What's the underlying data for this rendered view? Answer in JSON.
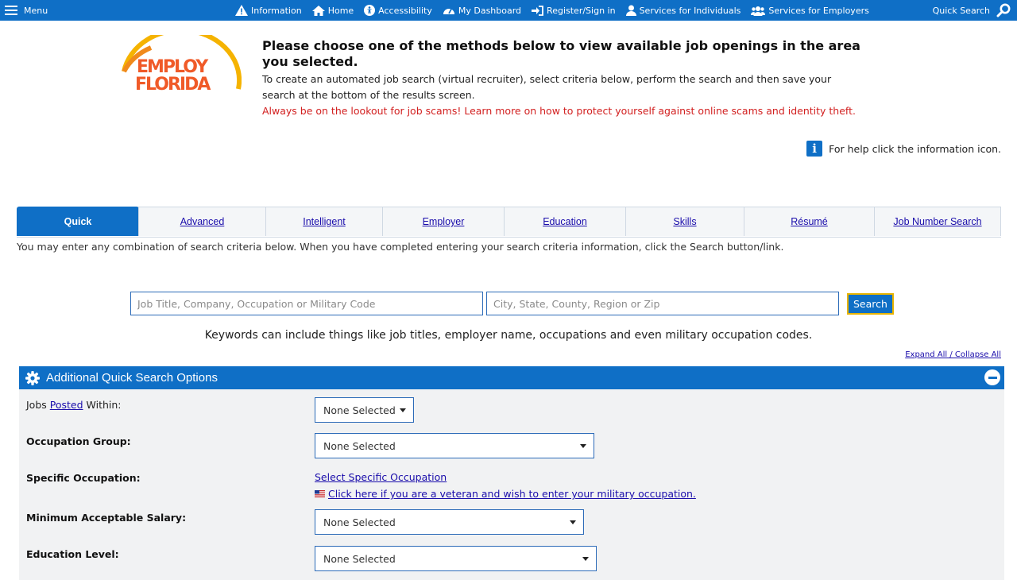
{
  "topbar": {
    "menu_label": "Menu",
    "nav": [
      {
        "label": "Information",
        "icon": "warning-icon"
      },
      {
        "label": "Home",
        "icon": "home-icon"
      },
      {
        "label": "Accessibility",
        "icon": "accessibility-icon"
      },
      {
        "label": "My Dashboard",
        "icon": "dashboard-icon"
      },
      {
        "label": "Register/Sign in",
        "icon": "sign-in-icon"
      },
      {
        "label": "Services for Individuals",
        "icon": "person-icon"
      },
      {
        "label": "Services for Employers",
        "icon": "group-icon"
      }
    ],
    "quick_search_label": "Quick Search",
    "bar_color": "#0f6fc6"
  },
  "logo": {
    "line1": "EMPLOY",
    "line2": "FLORIDA"
  },
  "header": {
    "title": "Please choose one of the methods below to view available job openings in the area you selected.",
    "description": "To create an automated job search (virtual recruiter), select criteria below, perform the search and then save your search at the bottom of the results screen.",
    "warning_prefix": "Always be on the lookout for job scams!  Learn more on how to protect yourself against ",
    "warning_link": "online scams and identity theft",
    "warning_suffix": "."
  },
  "help": {
    "text": "For help click the information icon.",
    "icon_glyph": "i"
  },
  "tabs": [
    {
      "label": "Quick",
      "active": true
    },
    {
      "label": "Advanced",
      "active": false
    },
    {
      "label": "Intelligent",
      "active": false
    },
    {
      "label": "Employer",
      "active": false
    },
    {
      "label": "Education",
      "active": false
    },
    {
      "label": "Skills",
      "active": false
    },
    {
      "label": "Résumé",
      "active": false
    },
    {
      "label": "Job Number Search",
      "active": false
    }
  ],
  "tab_intro": "You may enter any combination of search criteria below. When you have completed entering your search criteria information, click the Search button/link.",
  "search": {
    "keyword_placeholder": "Job Title, Company, Occupation or Military Code",
    "keyword_value": "",
    "location_placeholder": "City, State, County, Region or Zip",
    "location_value": "",
    "button_label": "Search"
  },
  "keywords_note": "Keywords can include things like job titles, employer name, occupations and even military occupation codes.",
  "expand_collapse": "Expand All / Collapse All",
  "options_panel": {
    "title": "Additional Quick Search Options",
    "jobs_posted": {
      "prefix": "Jobs ",
      "link": "Posted",
      "suffix": " Within:",
      "value": "None Selected"
    },
    "occupation_group": {
      "label": "Occupation Group:",
      "value": "None Selected"
    },
    "specific_occupation": {
      "label": "Specific Occupation:",
      "link": "Select Specific Occupation",
      "veteran_link": "Click here if you are a veteran and wish to enter your military occupation."
    },
    "min_salary": {
      "label": "Minimum Acceptable Salary:",
      "value": "None Selected"
    },
    "education_level": {
      "label": "Education Level:",
      "value": "None Selected"
    }
  }
}
